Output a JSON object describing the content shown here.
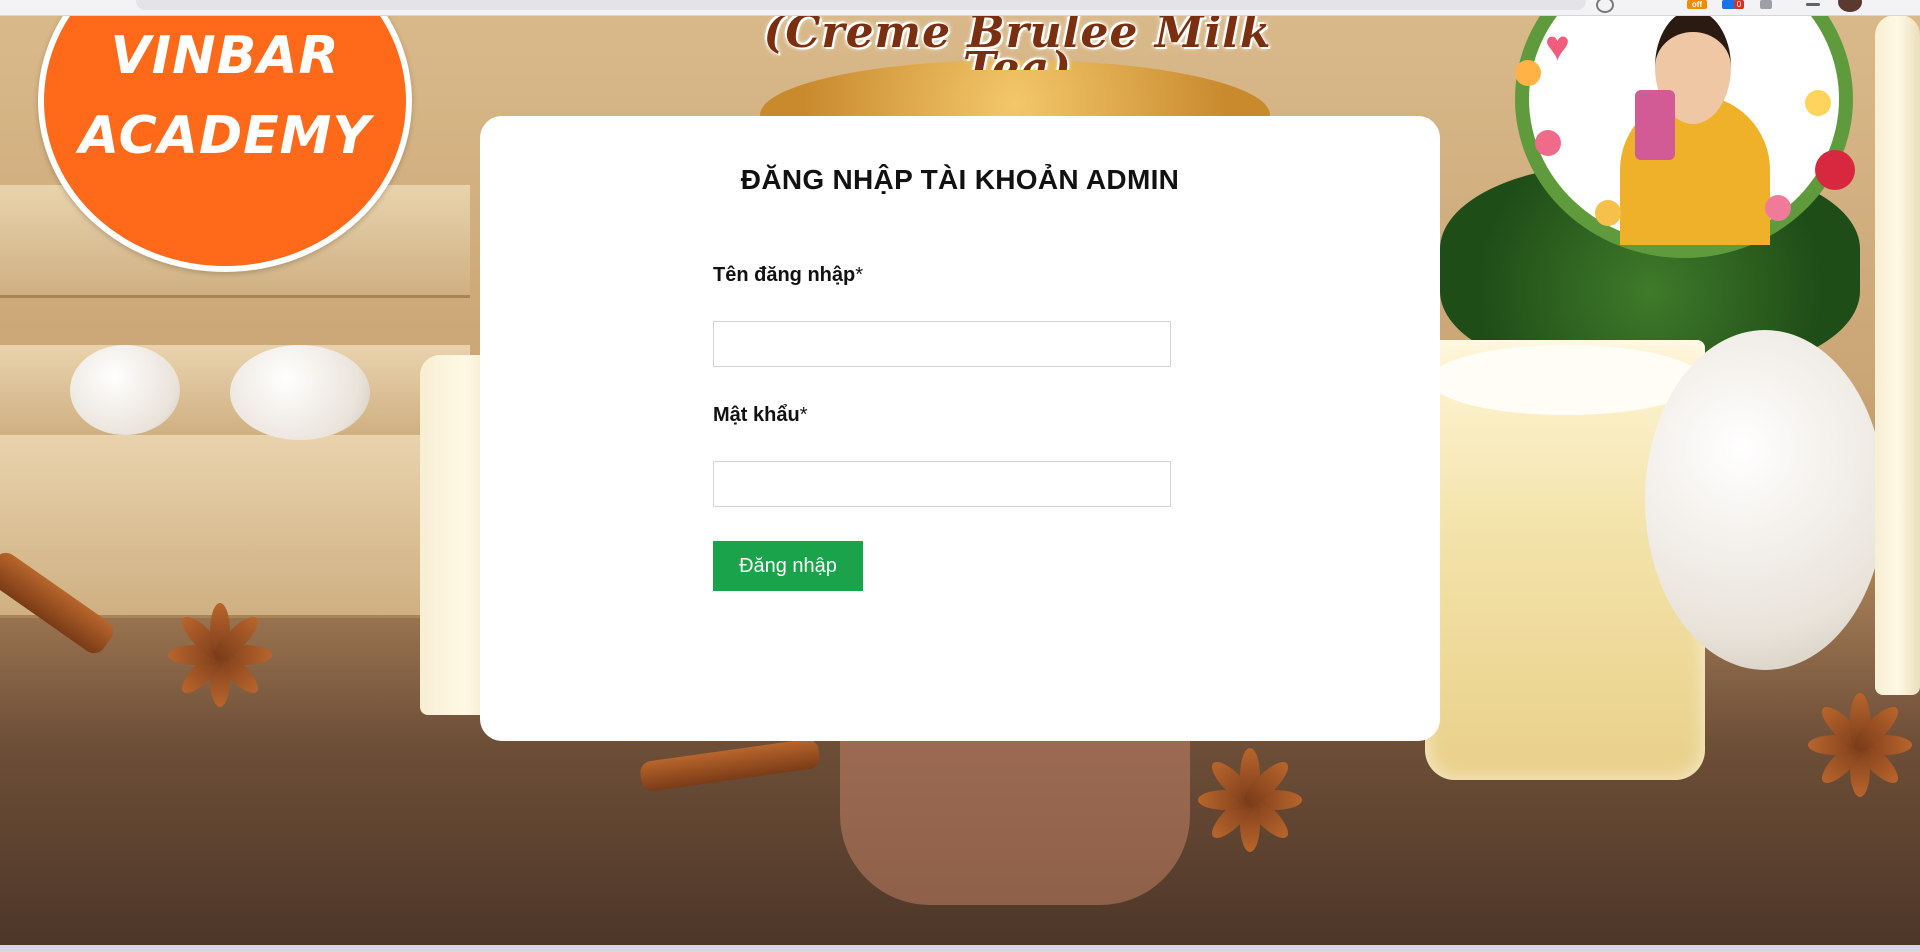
{
  "page": {
    "banner_title": "(Creme Brulee Milk Tea)",
    "logo": {
      "line1": "VINBAR",
      "line2": "ACADEMY"
    }
  },
  "browser": {
    "extension_badge_off": "off",
    "extension_badge_count": "0"
  },
  "login": {
    "title": "ĐĂNG NHẬP TÀI KHOẢN ADMIN",
    "username_label": "Tên đăng nhập",
    "password_label": "Mật khẩu",
    "required_mark": "*",
    "username_value": "",
    "password_value": "",
    "submit_label": "Đăng nhập"
  },
  "colors": {
    "submit_button": "#1aa34a",
    "logo_orange": "#ff6a1a",
    "card_background": "#ffffff"
  },
  "icons": [
    "extension-off-icon",
    "extension-badge-icon",
    "menu-icon",
    "profile-avatar-icon"
  ]
}
